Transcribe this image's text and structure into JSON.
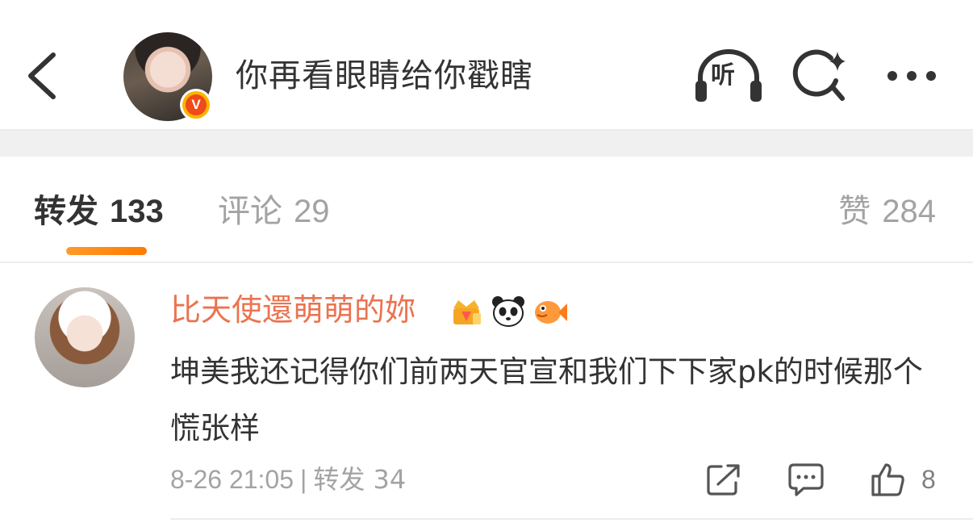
{
  "header": {
    "title": "你再看眼睛给你戳瞎",
    "verified_mark": "V",
    "listen_label": "听"
  },
  "tabs": [
    {
      "label": "转发",
      "count": "133",
      "active": true
    },
    {
      "label": "评论",
      "count": "29",
      "active": false
    },
    {
      "label": "赞",
      "count": "284",
      "active": false
    }
  ],
  "repost": {
    "user_name": "比天使還萌萌的妳",
    "badges": [
      "crown-badge-icon",
      "panda-badge-icon",
      "fish-badge-icon"
    ],
    "text": "坤美我还记得你们前两天官宣和我们下下家pk的时候那个慌张样",
    "time": "8-26 21:05",
    "separator": "|",
    "repost_label": "转发 34",
    "like_count": "8"
  },
  "colors": {
    "accent": "#ff8200",
    "username": "#eb7350",
    "text": "#333333",
    "muted": "#a3a3a3",
    "verified": "#f04a19"
  }
}
